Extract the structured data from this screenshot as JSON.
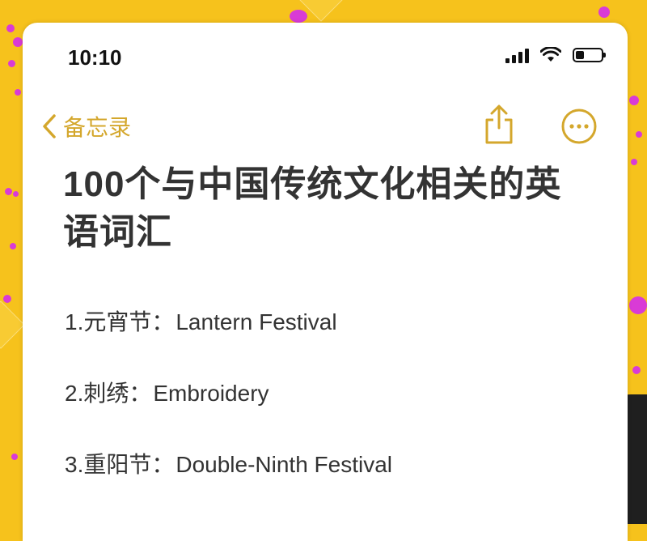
{
  "status_bar": {
    "time": "10:10"
  },
  "nav": {
    "back_label": "备忘录"
  },
  "note": {
    "title": "100个与中国传统文化相关的英语词汇",
    "items": [
      {
        "cn": "1.元宵节：",
        "en": "Lantern Festival"
      },
      {
        "cn": "2.刺绣：",
        "en": "Embroidery"
      },
      {
        "cn": "3.重阳节：",
        "en": "Double-Ninth Festival"
      }
    ]
  },
  "colors": {
    "accent": "#d4a72c",
    "background": "#f6c21c",
    "dots": "#d93bd6"
  },
  "icons": {
    "back": "chevron-left-icon",
    "share": "share-icon",
    "more": "ellipsis-circle-icon"
  }
}
